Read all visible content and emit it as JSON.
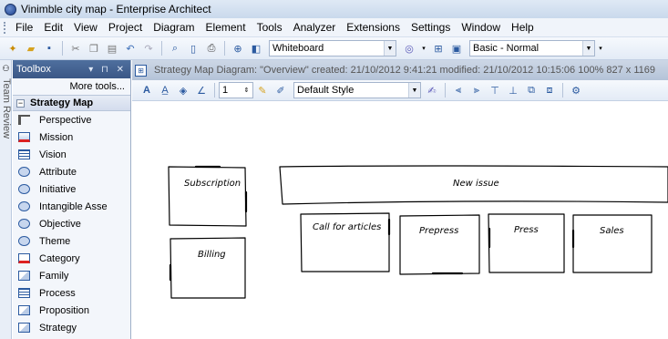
{
  "window": {
    "title": "Vinimble city map - Enterprise Architect"
  },
  "menu": [
    "File",
    "Edit",
    "View",
    "Project",
    "Diagram",
    "Element",
    "Tools",
    "Analyzer",
    "Extensions",
    "Settings",
    "Window",
    "Help"
  ],
  "toolbar": {
    "workspace_value": "Whiteboard",
    "style_value": "Basic - Normal"
  },
  "team_review": {
    "label": "Team Review"
  },
  "toolbox": {
    "title": "Toolbox",
    "more_tools": "More tools...",
    "group": "Strategy Map",
    "items": [
      {
        "label": "Perspective",
        "icon": "perspective-icon"
      },
      {
        "label": "Mission",
        "icon": "mission-icon"
      },
      {
        "label": "Vision",
        "icon": "vision-icon"
      },
      {
        "label": "Attribute",
        "icon": "attribute-icon"
      },
      {
        "label": "Initiative",
        "icon": "initiative-icon"
      },
      {
        "label": "Intangible Asse",
        "icon": "intangible-asset-icon"
      },
      {
        "label": "Objective",
        "icon": "objective-icon"
      },
      {
        "label": "Theme",
        "icon": "theme-icon"
      },
      {
        "label": "Category",
        "icon": "category-icon"
      },
      {
        "label": "Family",
        "icon": "family-icon"
      },
      {
        "label": "Process",
        "icon": "process-icon"
      },
      {
        "label": "Proposition",
        "icon": "proposition-icon"
      },
      {
        "label": "Strategy",
        "icon": "strategy-icon"
      }
    ]
  },
  "diagram": {
    "header": "Strategy Map Diagram: \"Overview\"  created: 21/10/2012 9:41:21  modified: 21/10/2012 10:15:06  100%  827 x 1169",
    "line_width_value": "1",
    "style_value": "Default Style",
    "shapes": {
      "subscription": "Subscription",
      "new_issue": "New issue",
      "billing": "Billing",
      "call_for_articles": "Call for articles",
      "prepress": "Prepress",
      "press": "Press",
      "sales": "Sales"
    }
  }
}
